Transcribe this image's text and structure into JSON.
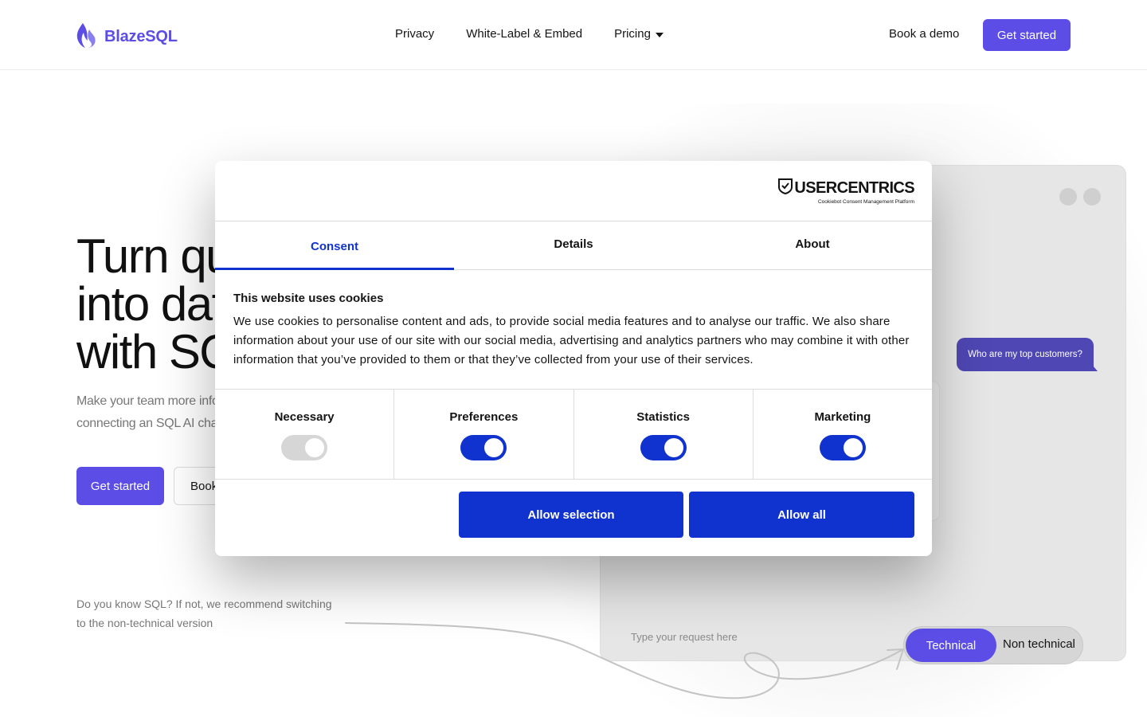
{
  "header": {
    "logo_text": "BlazeSQL",
    "nav": [
      {
        "label": "Privacy"
      },
      {
        "label": "White-Label & Embed"
      },
      {
        "label": "Pricing"
      }
    ],
    "book_demo": "Book a demo",
    "get_started": "Get started"
  },
  "hero": {
    "title_lines": [
      "Turn qu",
      "into dat",
      "with SQ"
    ],
    "subtitle_lines": [
      "Make your team more infor",
      "connecting an SQL AI chat"
    ],
    "cta_primary": "Get started",
    "cta_secondary": "Book",
    "hint": "Do you know SQL? If not, we recommend switching to the non-technical version"
  },
  "mockup": {
    "chat_bubble": "Who are my top customers?",
    "input_placeholder": "Type your request here",
    "toggle_technical": "Technical",
    "toggle_non_technical": "Non technical"
  },
  "cookie_dialog": {
    "brand_name": "USERCENTRICS",
    "brand_sub": "Cookiebot Consent Management Platform",
    "tabs": [
      {
        "label": "Consent",
        "active": true
      },
      {
        "label": "Details",
        "active": false
      },
      {
        "label": "About",
        "active": false
      }
    ],
    "title": "This website uses cookies",
    "body": "We use cookies to personalise content and ads, to provide social media features and to analyse our traffic. We also share information about your use of our site with our social media, advertising and analytics partners who may combine it with other information that you’ve provided to them or that they’ve collected from your use of their services.",
    "categories": [
      {
        "label": "Necessary",
        "enabled": true,
        "locked": true
      },
      {
        "label": "Preferences",
        "enabled": true,
        "locked": false
      },
      {
        "label": "Statistics",
        "enabled": true,
        "locked": false
      },
      {
        "label": "Marketing",
        "enabled": true,
        "locked": false
      }
    ],
    "allow_selection": "Allow selection",
    "allow_all": "Allow all"
  },
  "colors": {
    "brand_purple": "#5b4de6",
    "cookie_blue": "#1032cf",
    "bubble_purple": "#4f47b3"
  }
}
